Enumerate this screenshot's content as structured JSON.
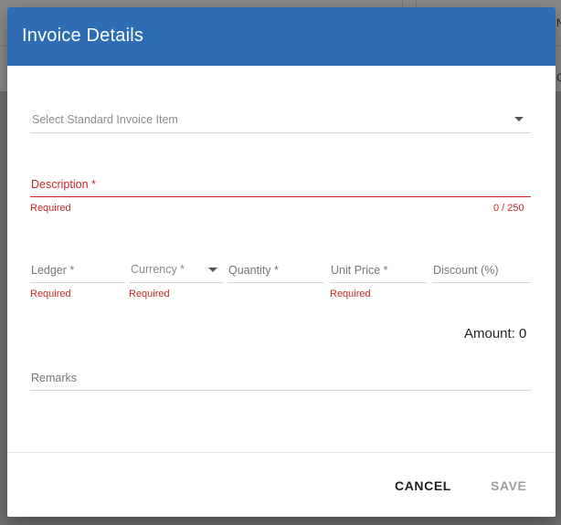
{
  "background": {
    "glyph_top": "N",
    "glyph_mid": "C"
  },
  "dialog": {
    "title": "Invoice Details"
  },
  "fields": {
    "standard_item": {
      "placeholder": "Select Standard Invoice Item"
    },
    "description": {
      "label": "Description *",
      "helper": "Required",
      "counter": "0 / 250"
    },
    "ledger": {
      "label": "Ledger *",
      "helper": "Required"
    },
    "currency": {
      "label": "Currency *",
      "helper": "Required"
    },
    "quantity": {
      "label": "Quantity *"
    },
    "unit_price": {
      "label": "Unit Price *",
      "helper": "Required"
    },
    "discount": {
      "label": "Discount (%)"
    },
    "remarks": {
      "label": "Remarks"
    }
  },
  "amount": {
    "text": "Amount: 0"
  },
  "actions": {
    "cancel": "CANCEL",
    "save": "SAVE"
  },
  "colors": {
    "header": "#2e6db4",
    "error": "#c62828",
    "disabled": "#9e9e9e"
  }
}
